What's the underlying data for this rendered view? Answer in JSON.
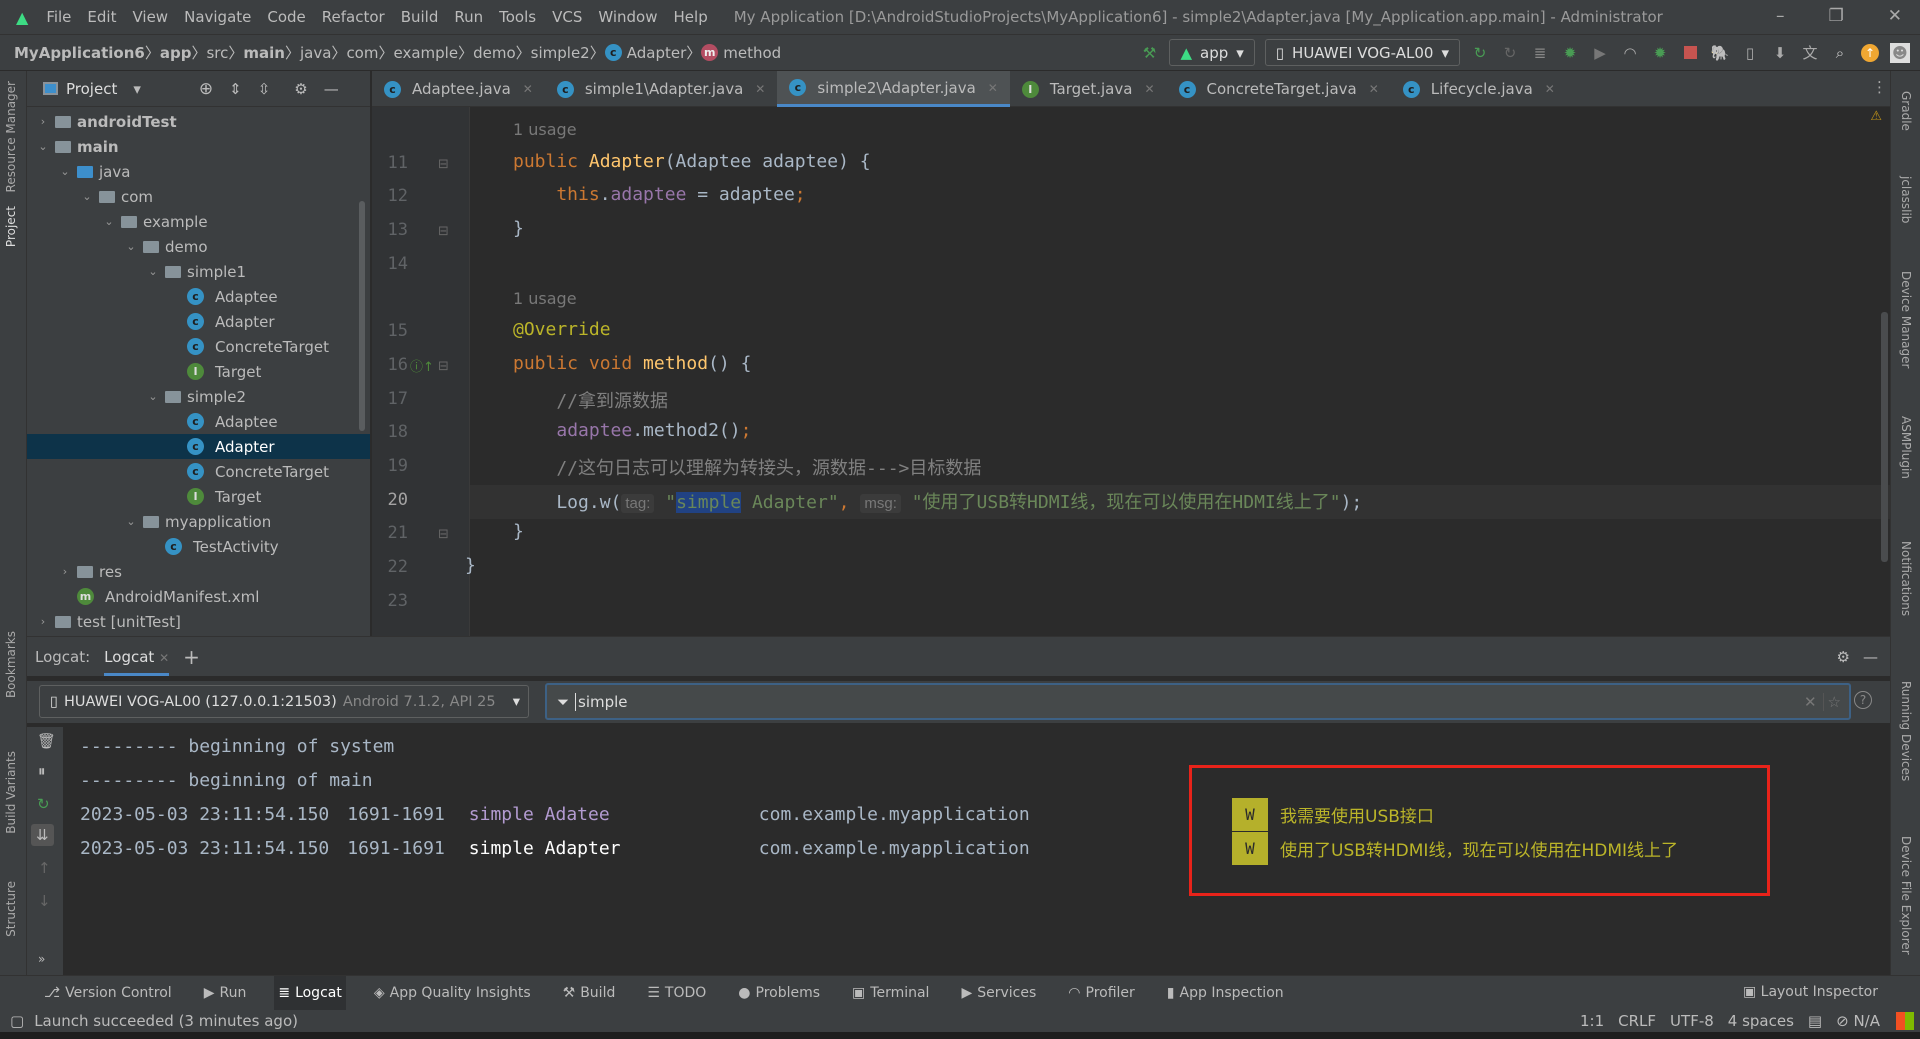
{
  "window": {
    "menu": [
      "File",
      "Edit",
      "View",
      "Navigate",
      "Code",
      "Refactor",
      "Build",
      "Run",
      "Tools",
      "VCS",
      "Window",
      "Help"
    ],
    "title": "My Application [D:\\AndroidStudioProjects\\MyApplication6] - simple2\\Adapter.java [My_Application.app.main] - Administrator",
    "controls": [
      "–",
      "❐",
      "✕"
    ]
  },
  "breadcrumb": [
    "MyApplication6",
    "app",
    "src",
    "main",
    "java",
    "com",
    "example",
    "demo",
    "simple2",
    "Adapter",
    "method"
  ],
  "toolbar": {
    "run_config": "app",
    "device": "HUAWEI VOG-AL00"
  },
  "left_strip": [
    "Resource Manager",
    "Project",
    "Bookmarks",
    "Build Variants",
    "Structure"
  ],
  "right_strip": [
    "Gradle",
    "jclasslib",
    "Device Manager",
    "ASMPlugin",
    "Notifications",
    "Running Devices",
    "Device File Explorer"
  ],
  "project": {
    "title": "Project",
    "tree": [
      {
        "label": "androidTest",
        "depth": 0,
        "chev": "›",
        "icon": "folder",
        "bold": true
      },
      {
        "label": "main",
        "depth": 0,
        "chev": "⌄",
        "icon": "folder",
        "bold": true
      },
      {
        "label": "java",
        "depth": 1,
        "chev": "⌄",
        "icon": "folder-blue"
      },
      {
        "label": "com",
        "depth": 2,
        "chev": "⌄",
        "icon": "folder"
      },
      {
        "label": "example",
        "depth": 3,
        "chev": "⌄",
        "icon": "folder"
      },
      {
        "label": "demo",
        "depth": 4,
        "chev": "⌄",
        "icon": "folder"
      },
      {
        "label": "simple1",
        "depth": 5,
        "chev": "⌄",
        "icon": "folder"
      },
      {
        "label": "Adaptee",
        "depth": 6,
        "icon": "class"
      },
      {
        "label": "Adapter",
        "depth": 6,
        "icon": "class"
      },
      {
        "label": "ConcreteTarget",
        "depth": 6,
        "icon": "class"
      },
      {
        "label": "Target",
        "depth": 6,
        "icon": "interface"
      },
      {
        "label": "simple2",
        "depth": 5,
        "chev": "⌄",
        "icon": "folder"
      },
      {
        "label": "Adaptee",
        "depth": 6,
        "icon": "class"
      },
      {
        "label": "Adapter",
        "depth": 6,
        "icon": "class",
        "selected": true
      },
      {
        "label": "ConcreteTarget",
        "depth": 6,
        "icon": "class"
      },
      {
        "label": "Target",
        "depth": 6,
        "icon": "interface"
      },
      {
        "label": "myapplication",
        "depth": 4,
        "chev": "⌄",
        "icon": "folder"
      },
      {
        "label": "TestActivity",
        "depth": 5,
        "icon": "class"
      },
      {
        "label": "res",
        "depth": 1,
        "chev": "›",
        "icon": "folder"
      },
      {
        "label": "AndroidManifest.xml",
        "depth": 1,
        "icon": "manifest"
      },
      {
        "label": "test [unitTest]",
        "depth": 0,
        "chev": "›",
        "icon": "folder"
      }
    ]
  },
  "tabs": [
    {
      "label": "Adaptee.java",
      "icon": "C"
    },
    {
      "label": "simple1\\Adapter.java",
      "icon": "C"
    },
    {
      "label": "simple2\\Adapter.java",
      "icon": "C",
      "active": true
    },
    {
      "label": "Target.java",
      "icon": "I"
    },
    {
      "label": "ConcreteTarget.java",
      "icon": "C"
    },
    {
      "label": "Lifecycle.java",
      "icon": "C"
    }
  ],
  "editor": {
    "lines": [
      {
        "usage": "1 usage"
      },
      {
        "n": "11",
        "tokens": [
          [
            "public ",
            "k"
          ],
          [
            "Adapter",
            "fn"
          ],
          [
            "(Adaptee adaptee) {",
            ""
          ]
        ]
      },
      {
        "n": "12",
        "tokens": [
          [
            "    this",
            "k"
          ],
          [
            ".",
            ""
          ],
          [
            "adaptee",
            "fld"
          ],
          [
            " = adaptee",
            ""
          ],
          [
            ";",
            "k"
          ]
        ]
      },
      {
        "n": "13",
        "tokens": [
          [
            "}",
            ""
          ]
        ]
      },
      {
        "n": "14",
        "tokens": []
      },
      {
        "usage": "1 usage"
      },
      {
        "n": "15",
        "tokens": [
          [
            "@Override",
            "ann"
          ]
        ]
      },
      {
        "n": "16",
        "tokens": [
          [
            "public void ",
            "k"
          ],
          [
            "method",
            "fn"
          ],
          [
            "() {",
            ""
          ]
        ]
      },
      {
        "n": "17",
        "tokens": [
          [
            "    //拿到源数据",
            "cm"
          ]
        ]
      },
      {
        "n": "18",
        "tokens": [
          [
            "    ",
            ""
          ],
          [
            "adaptee",
            "fld"
          ],
          [
            ".method2()",
            ""
          ],
          [
            ";",
            "k"
          ]
        ]
      },
      {
        "n": "19",
        "tokens": [
          [
            "    //这句日志可以理解为转接头，源数据--->目标数据",
            "cm"
          ]
        ]
      },
      {
        "n": "20",
        "current": true,
        "tokens": [
          [
            "    Log.w(",
            ""
          ],
          [
            "tag:",
            "hint"
          ],
          [
            " \"",
            "str"
          ],
          [
            "simple",
            "str hl"
          ],
          [
            " Adapter\"",
            "str"
          ],
          [
            ", ",
            "k"
          ],
          [
            "msg:",
            "hint"
          ],
          [
            " \"使用了USB转HDMI线，现在可以使用在HDMI线上了\"",
            "str"
          ],
          [
            ");",
            ""
          ]
        ]
      },
      {
        "n": "21",
        "tokens": [
          [
            "}",
            ""
          ]
        ]
      },
      {
        "n": "22",
        "tokens": [
          [
            "}",
            ""
          ]
        ],
        "outer": true
      },
      {
        "n": "23",
        "tokens": []
      }
    ]
  },
  "logcat": {
    "label": "Logcat:",
    "tab": "Logcat",
    "device": "HUAWEI VOG-AL00 (127.0.0.1:21503)",
    "device_extra": "Android 7.1.2, API 25",
    "filter": "simple",
    "lines": [
      {
        "text": "--------- beginning of system"
      },
      {
        "text": "--------- beginning of main"
      },
      {
        "time": "2023-05-03 23:11:54.150",
        "pid": "1691-1691",
        "tag": "simple Adatee",
        "pkg": "com.example.myapplication",
        "level": "W",
        "msg": "我需要使用USB接口"
      },
      {
        "time": "2023-05-03 23:11:54.150",
        "pid": "1691-1691",
        "tag": "simple Adapter",
        "pkg": "com.example.myapplication",
        "level": "W",
        "msg": "使用了USB转HDMI线，现在可以使用在HDMI线上了"
      }
    ]
  },
  "bottom_tools": [
    "Version Control",
    "Run",
    "Logcat",
    "App Quality Insights",
    "Build",
    "TODO",
    "Problems",
    "Terminal",
    "Services",
    "Profiler",
    "App Inspection"
  ],
  "layout_inspector": "Layout Inspector",
  "status": {
    "message": "Launch succeeded (3 minutes ago)",
    "position": "1:1",
    "line_sep": "CRLF",
    "encoding": "UTF-8",
    "indent": "4 spaces",
    "vcs": "N/A"
  },
  "colors": {
    "keyword": "#cc7832",
    "string": "#6a8759",
    "highlight_box": "#e8231a",
    "warn_level": "#b5b02b",
    "accent": "#4a88c7"
  }
}
